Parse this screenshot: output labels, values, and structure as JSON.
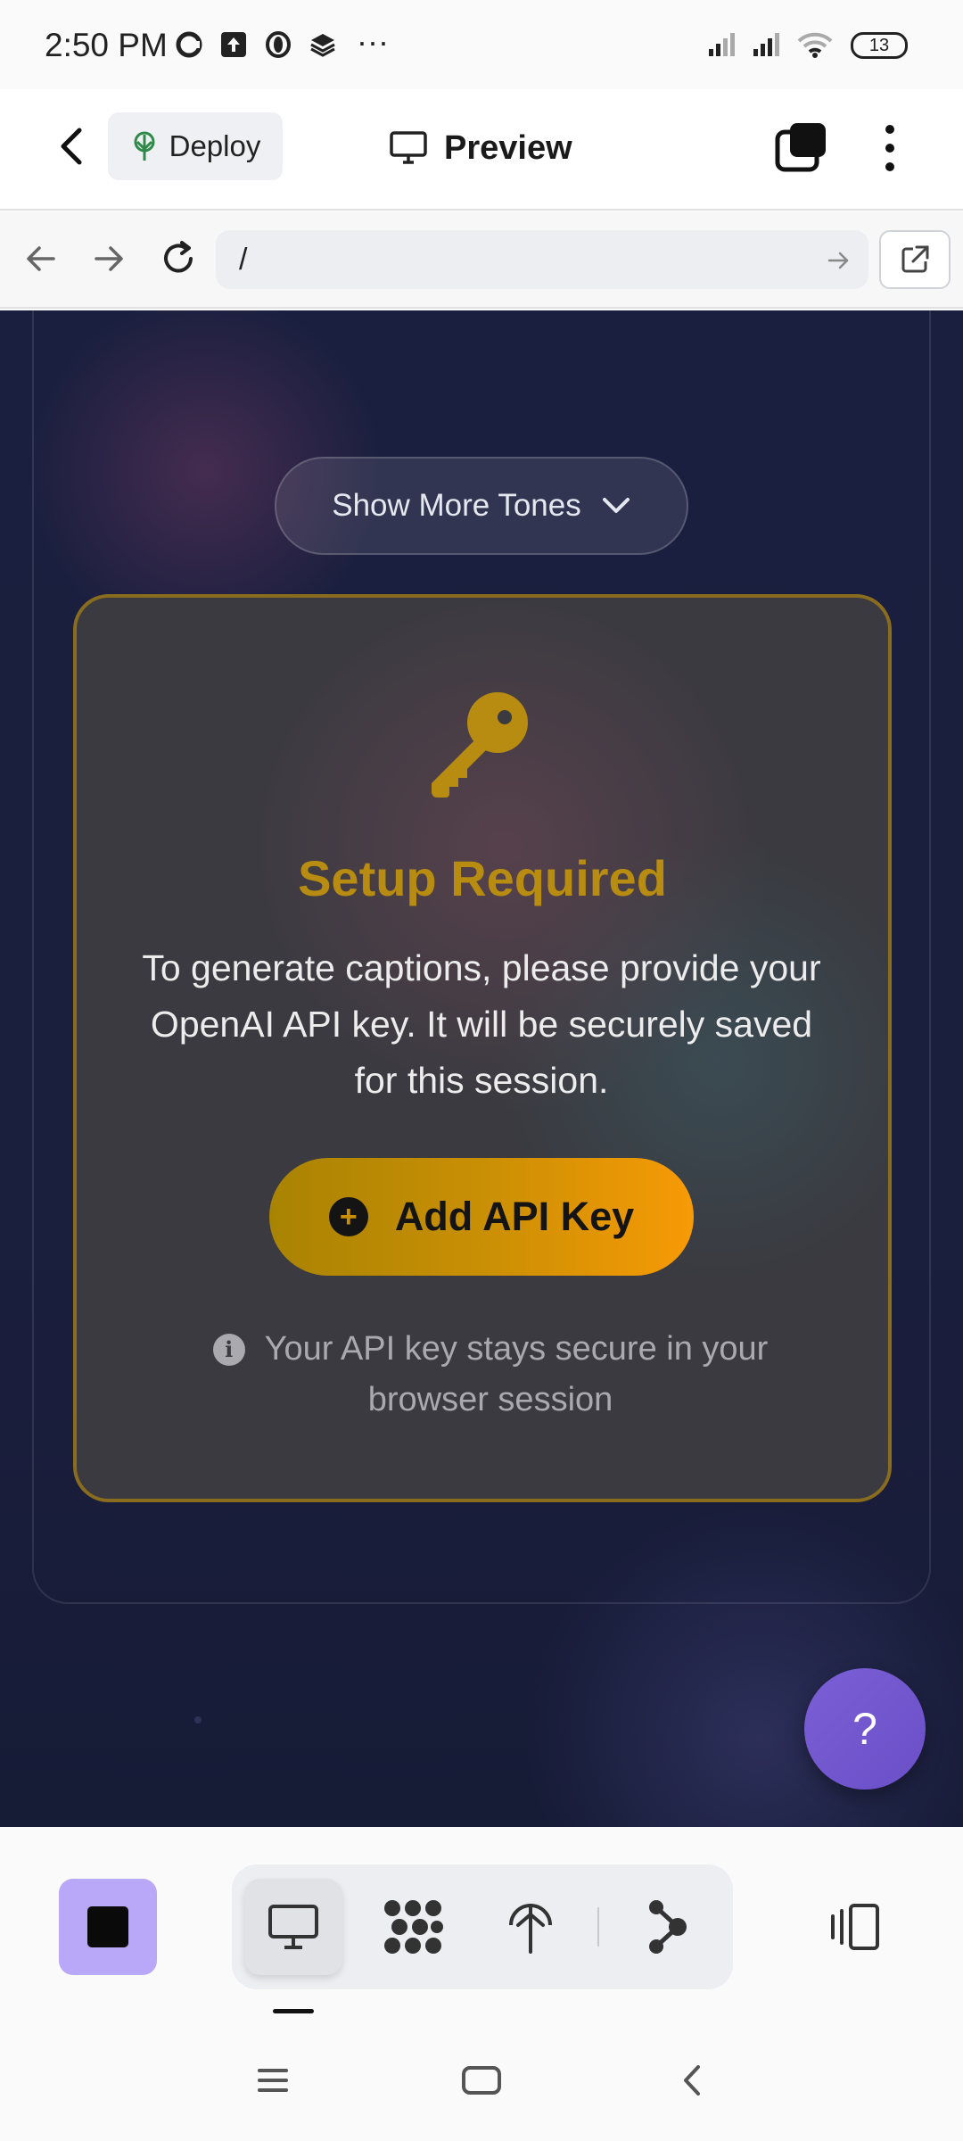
{
  "status_bar": {
    "time": "2:50 PM",
    "more": "···",
    "battery": "13"
  },
  "header": {
    "deploy_label": "Deploy",
    "preview_label": "Preview"
  },
  "url_bar": {
    "path": "/"
  },
  "content": {
    "tones_button_label": "Show More Tones",
    "setup_title": "Setup Required",
    "setup_description": "To generate captions, please provide your OpenAI API key. It will be securely saved for this session.",
    "add_key_label": "Add API Key",
    "hint_text": "Your API key stays secure in your browser session",
    "help_label": "?"
  },
  "colors": {
    "accent_gold": "#b88c10",
    "button_gradient_start": "#a98303",
    "button_gradient_end": "#f79a05",
    "help_purple": "#7a5fd6",
    "stop_purple": "#b9a7f8",
    "page_dark": "#1a1f3f"
  },
  "icons": {
    "status": [
      "c-app-icon",
      "upload-icon",
      "opera-icon",
      "layers-icon",
      "signal-icon",
      "signal-icon",
      "wifi-icon",
      "battery-icon"
    ],
    "toolbar": [
      "stop-icon",
      "monitor-icon",
      "grid-dots-icon",
      "deploy-tree-icon",
      "branch-icon",
      "device-toggle-icon"
    ],
    "nav": [
      "menu-icon",
      "home-icon",
      "back-icon"
    ]
  }
}
